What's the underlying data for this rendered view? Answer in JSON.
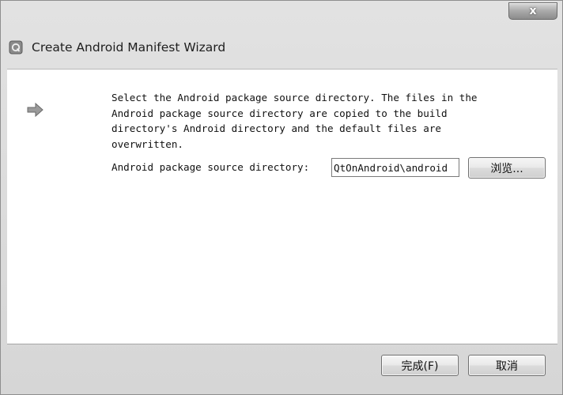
{
  "window": {
    "title": "Create Android Manifest Wizard",
    "close_glyph": "x"
  },
  "page": {
    "description": "Select the Android package source directory. The files in the\nAndroid package source directory are copied to the build\ndirectory's Android directory and the default files are\noverwritten.",
    "directory_label": "Android package source directory:",
    "directory_value": "QtOnAndroid\\android",
    "browse_label": "浏览..."
  },
  "footer": {
    "finish_label": "完成(F)",
    "cancel_label": "取消"
  },
  "icons": {
    "app": "qt-creator-app-icon",
    "step": "arrow-right-icon"
  }
}
